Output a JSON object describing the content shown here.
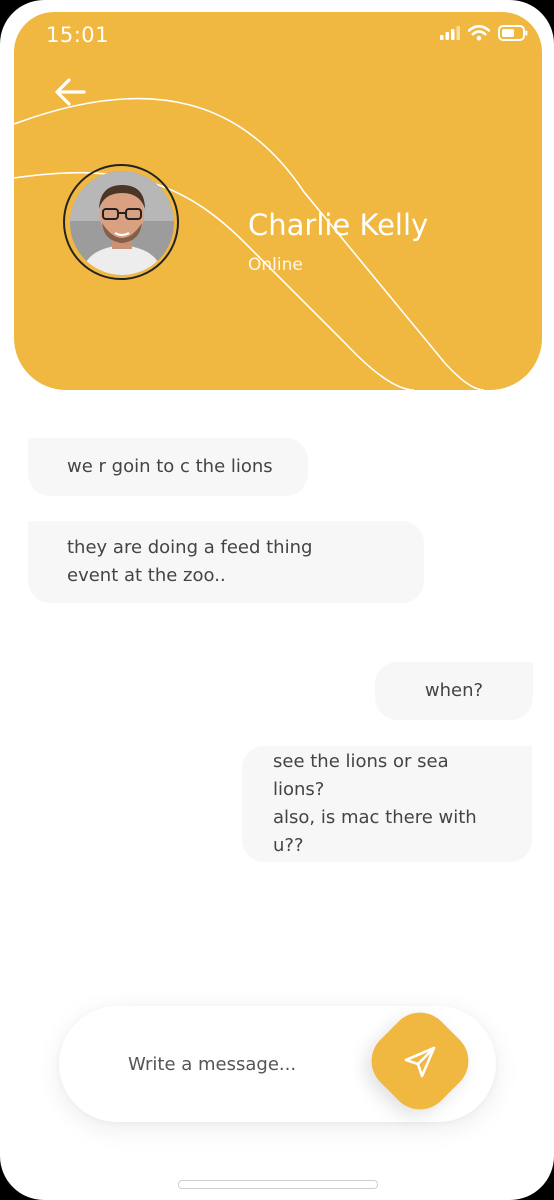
{
  "status_bar": {
    "time": "15:01"
  },
  "header": {
    "background_color": "#f0b840",
    "contact_name": "Charlie Kelly",
    "contact_status": "Online"
  },
  "messages": [
    {
      "direction": "incoming",
      "text": "we r goin to c the lions"
    },
    {
      "direction": "incoming",
      "text": "they are doing a feed thing\nevent at the zoo.."
    },
    {
      "direction": "outgoing",
      "text": "when?"
    },
    {
      "direction": "outgoing",
      "text": "see the lions or sea lions?\nalso, is mac there with\nu??"
    }
  ],
  "composer": {
    "placeholder": "Write a message...",
    "value": ""
  },
  "icons": {
    "back": "arrow-left-icon",
    "send": "send-icon",
    "signal": "signal-icon",
    "wifi": "wifi-icon",
    "battery": "battery-icon"
  }
}
